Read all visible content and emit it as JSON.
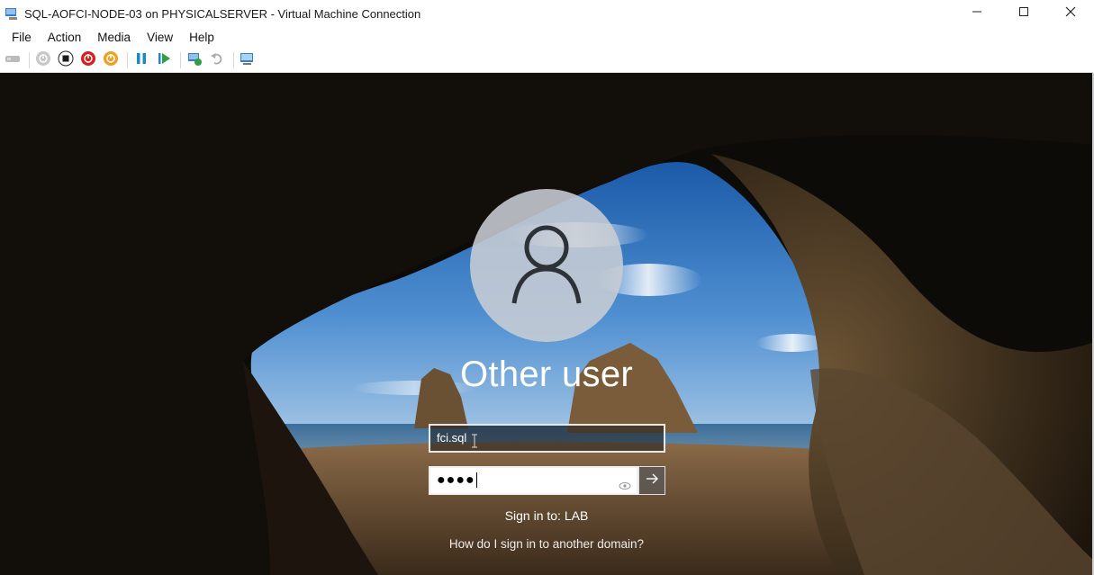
{
  "window": {
    "title": "SQL-AOFCI-NODE-03 on PHYSICALSERVER - Virtual Machine Connection",
    "icon": "vm-connect-icon"
  },
  "window_controls": [
    "minimize-icon",
    "maximize-icon",
    "close-icon"
  ],
  "menu": {
    "items": [
      "File",
      "Action",
      "Media",
      "View",
      "Help"
    ]
  },
  "toolbar": {
    "icons": [
      "ctrl-alt-del-icon",
      "start-icon",
      "turn-off-icon",
      "shut-down-icon",
      "save-state-icon",
      "pause-icon",
      "resume-icon",
      "checkpoint-icon",
      "revert-icon",
      "enhanced-session-icon"
    ]
  },
  "login": {
    "user_display_name": "Other user",
    "username_value": "fci.sql",
    "password_mask": "●●●●",
    "sign_in_to": "Sign in to: LAB",
    "other_domain_link": "How do I sign in to another domain?"
  },
  "colors": {
    "stop": "#1a1a1a",
    "turn_off": "#d81e1e",
    "shut_down": "#f0a020",
    "pause_resume": "#1e88c8",
    "resume": "#2ea043"
  }
}
